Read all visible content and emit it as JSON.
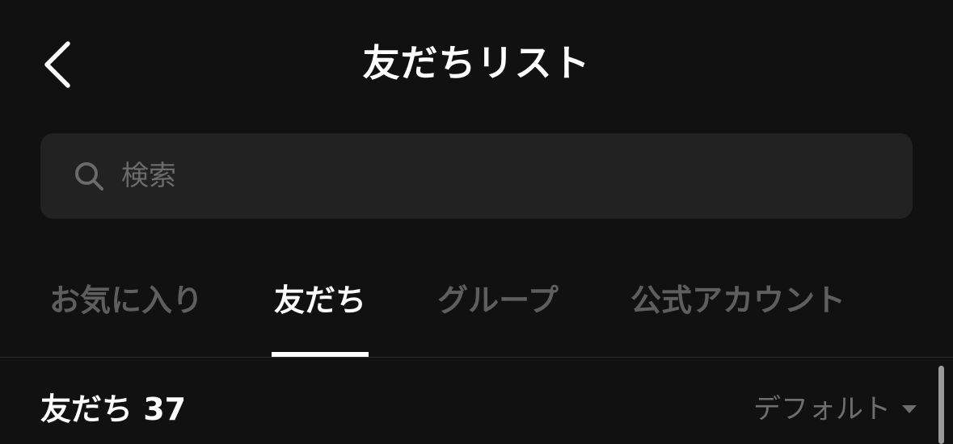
{
  "header": {
    "title": "友だちリスト",
    "back_icon": "chevron-left-icon"
  },
  "search": {
    "placeholder": "検索",
    "value": "",
    "icon": "search-icon"
  },
  "tabs": [
    {
      "label": "お気に入り",
      "active": false
    },
    {
      "label": "友だち",
      "active": true
    },
    {
      "label": "グループ",
      "active": false
    },
    {
      "label": "公式アカウント",
      "active": false
    }
  ],
  "section": {
    "title": "友だち 37",
    "sort_label": "デフォルト",
    "sort_icon": "caret-down-icon"
  },
  "colors": {
    "background": "#111111",
    "search_bg": "#222222",
    "active_text": "#ffffff",
    "inactive_text": "#5e5e5e"
  }
}
